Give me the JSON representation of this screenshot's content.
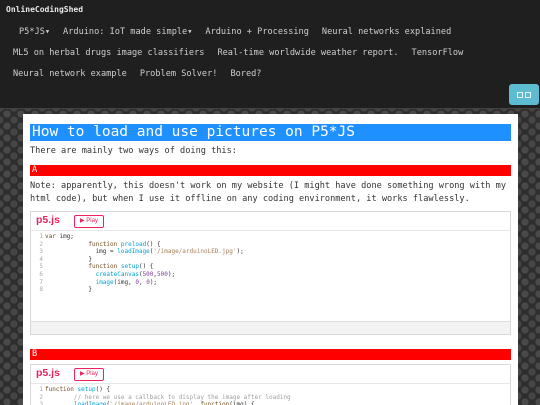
{
  "nav": {
    "brand": "OnlineCodingShed",
    "row1": [
      "P5*JS▾",
      "Arduino: IoT made simple▾",
      "Arduino + Processing",
      "Neural networks explained"
    ],
    "row2": [
      "ML5 on herbal drugs image classifiers",
      "Real-time worldwide weather report.",
      "TensorFlow"
    ],
    "row3": [
      "Neural network example",
      "Problem Solver!",
      "Bored?"
    ]
  },
  "page": {
    "title": "How to load and use pictures on P5*JS",
    "intro": "There are mainly two ways of doing this:",
    "section_a": "A",
    "note": "Note: apparently, this doesn't work on my website (I might have done something wrong with my html code), but when I use it offline on any coding environment, it works flawlessly.",
    "section_b": "B"
  },
  "editor": {
    "logo": "p5.js",
    "play": "▶ Play"
  },
  "code_a": [
    {
      "n": "1",
      "t": "var img;"
    },
    {
      "n": "2",
      "t": "            function preload() {"
    },
    {
      "n": "3",
      "t": "              img = loadImage('/image/arduinoLED.jpg');"
    },
    {
      "n": "4",
      "t": "            }"
    },
    {
      "n": "5",
      "t": "            function setup() {"
    },
    {
      "n": "6",
      "t": "              createCanvas(500,500);"
    },
    {
      "n": "7",
      "t": "              image(img, 0, 0);"
    },
    {
      "n": "8",
      "t": "            }"
    }
  ],
  "code_b": [
    {
      "n": "1",
      "t": "function setup() {"
    },
    {
      "n": "2",
      "t": "        // here we use a callback to display the image after loading"
    },
    {
      "n": "3",
      "t": "        loadImage('/image/arduinoLED.jpg', function(img) {"
    }
  ]
}
